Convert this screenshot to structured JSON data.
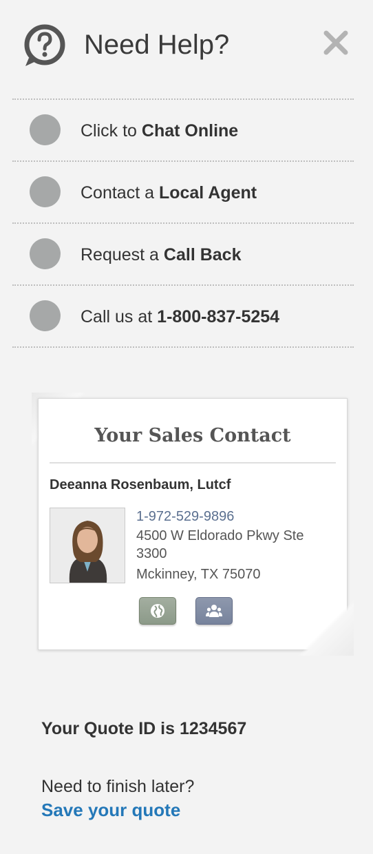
{
  "header": {
    "title": "Need Help?",
    "help_icon": "question-bubble-icon",
    "close_icon": "close-icon"
  },
  "options": [
    {
      "prefix": "Click to ",
      "bold": "Chat Online"
    },
    {
      "prefix": "Contact a ",
      "bold": "Local Agent"
    },
    {
      "prefix": "Request a ",
      "bold": "Call Back"
    },
    {
      "prefix": "Call us at ",
      "bold": "1-800-837-5254"
    }
  ],
  "sales_contact": {
    "title": "Your Sales Contact",
    "name": "Deeanna Rosenbaum, Lutcf",
    "phone": "1-972-529-9896",
    "address_line1": "4500 W Eldorado Pkwy Ste",
    "address_line2": "3300",
    "address_line3": "Mckinney, TX 75070",
    "buttons": [
      "globe-icon",
      "people-icon"
    ]
  },
  "quote": {
    "id_text": "Your Quote ID is 1234567",
    "finish_text": "Need to finish later?",
    "save_link": "Save your quote"
  },
  "colors": {
    "background": "#f3f3f3",
    "dot": "#a6a8a8",
    "link": "#2478b8",
    "phone": "#5a6f8f"
  }
}
